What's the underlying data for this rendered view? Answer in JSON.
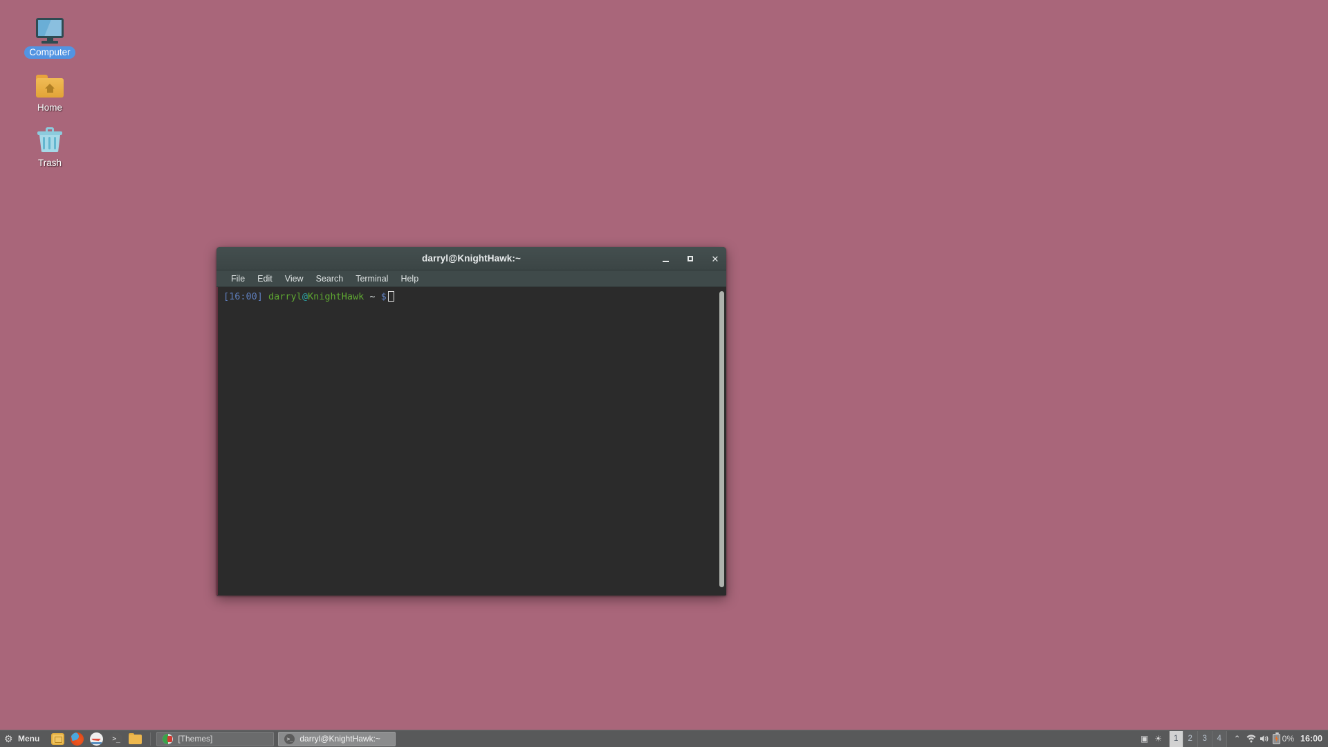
{
  "desktop": {
    "background_color": "#a9667a",
    "icons": [
      {
        "label": "Computer",
        "icon": "monitor-icon",
        "selected": true
      },
      {
        "label": "Home",
        "icon": "home-folder-icon",
        "selected": false
      },
      {
        "label": "Trash",
        "icon": "trash-icon",
        "selected": false
      }
    ]
  },
  "terminal": {
    "title": "darryl@KnightHawk:~",
    "menu": [
      "File",
      "Edit",
      "View",
      "Search",
      "Terminal",
      "Help"
    ],
    "window_controls": {
      "minimize": "minimize-icon",
      "maximize": "maximize-icon",
      "close": "close-icon"
    },
    "prompt": {
      "time": "[16:00]",
      "user": "darryl",
      "at": "@",
      "host": "KnightHawk",
      "path": "~",
      "symbol": "$"
    },
    "colors": {
      "time": "#5f7fbd",
      "user": "#5fa832",
      "at": "#2e9ea0",
      "host": "#5fa832",
      "path": "#c9cfcf",
      "symbol": "#5f7fbd",
      "background": "#2b2b2b",
      "titlebar": "#3f4a4a"
    }
  },
  "taskbar": {
    "menu_button": {
      "label": "Menu",
      "icon": "gear-icon"
    },
    "launchers": [
      {
        "name": "file-manager",
        "icon": "file-manager-icon"
      },
      {
        "name": "firefox",
        "icon": "firefox-icon"
      },
      {
        "name": "text-editor",
        "icon": "text-editor-icon"
      },
      {
        "name": "terminal",
        "icon": "terminal-icon",
        "glyph": ">_"
      },
      {
        "name": "folder",
        "icon": "folder-icon"
      }
    ],
    "windows": [
      {
        "label": "[Themes]",
        "icon": "themes-icon",
        "active": false
      },
      {
        "label": "darryl@KnightHawk:~",
        "icon": "terminal-icon",
        "glyph": ">_",
        "active": true
      }
    ],
    "tray": {
      "icons": [
        {
          "name": "display-icon",
          "glyph": "▣"
        },
        {
          "name": "brightness-icon",
          "glyph": "☀"
        }
      ],
      "workspaces": [
        {
          "label": "1",
          "active": true
        },
        {
          "label": "2",
          "active": false
        },
        {
          "label": "3",
          "active": false
        },
        {
          "label": "4",
          "active": false
        }
      ],
      "status_icons": [
        {
          "name": "chevron-up-icon",
          "glyph": "⌃"
        },
        {
          "name": "wifi-icon",
          "glyph": "▼"
        },
        {
          "name": "volume-icon",
          "glyph": "🔊"
        }
      ],
      "battery": {
        "percent": "0%",
        "charging": true
      },
      "clock": "16:00"
    }
  }
}
